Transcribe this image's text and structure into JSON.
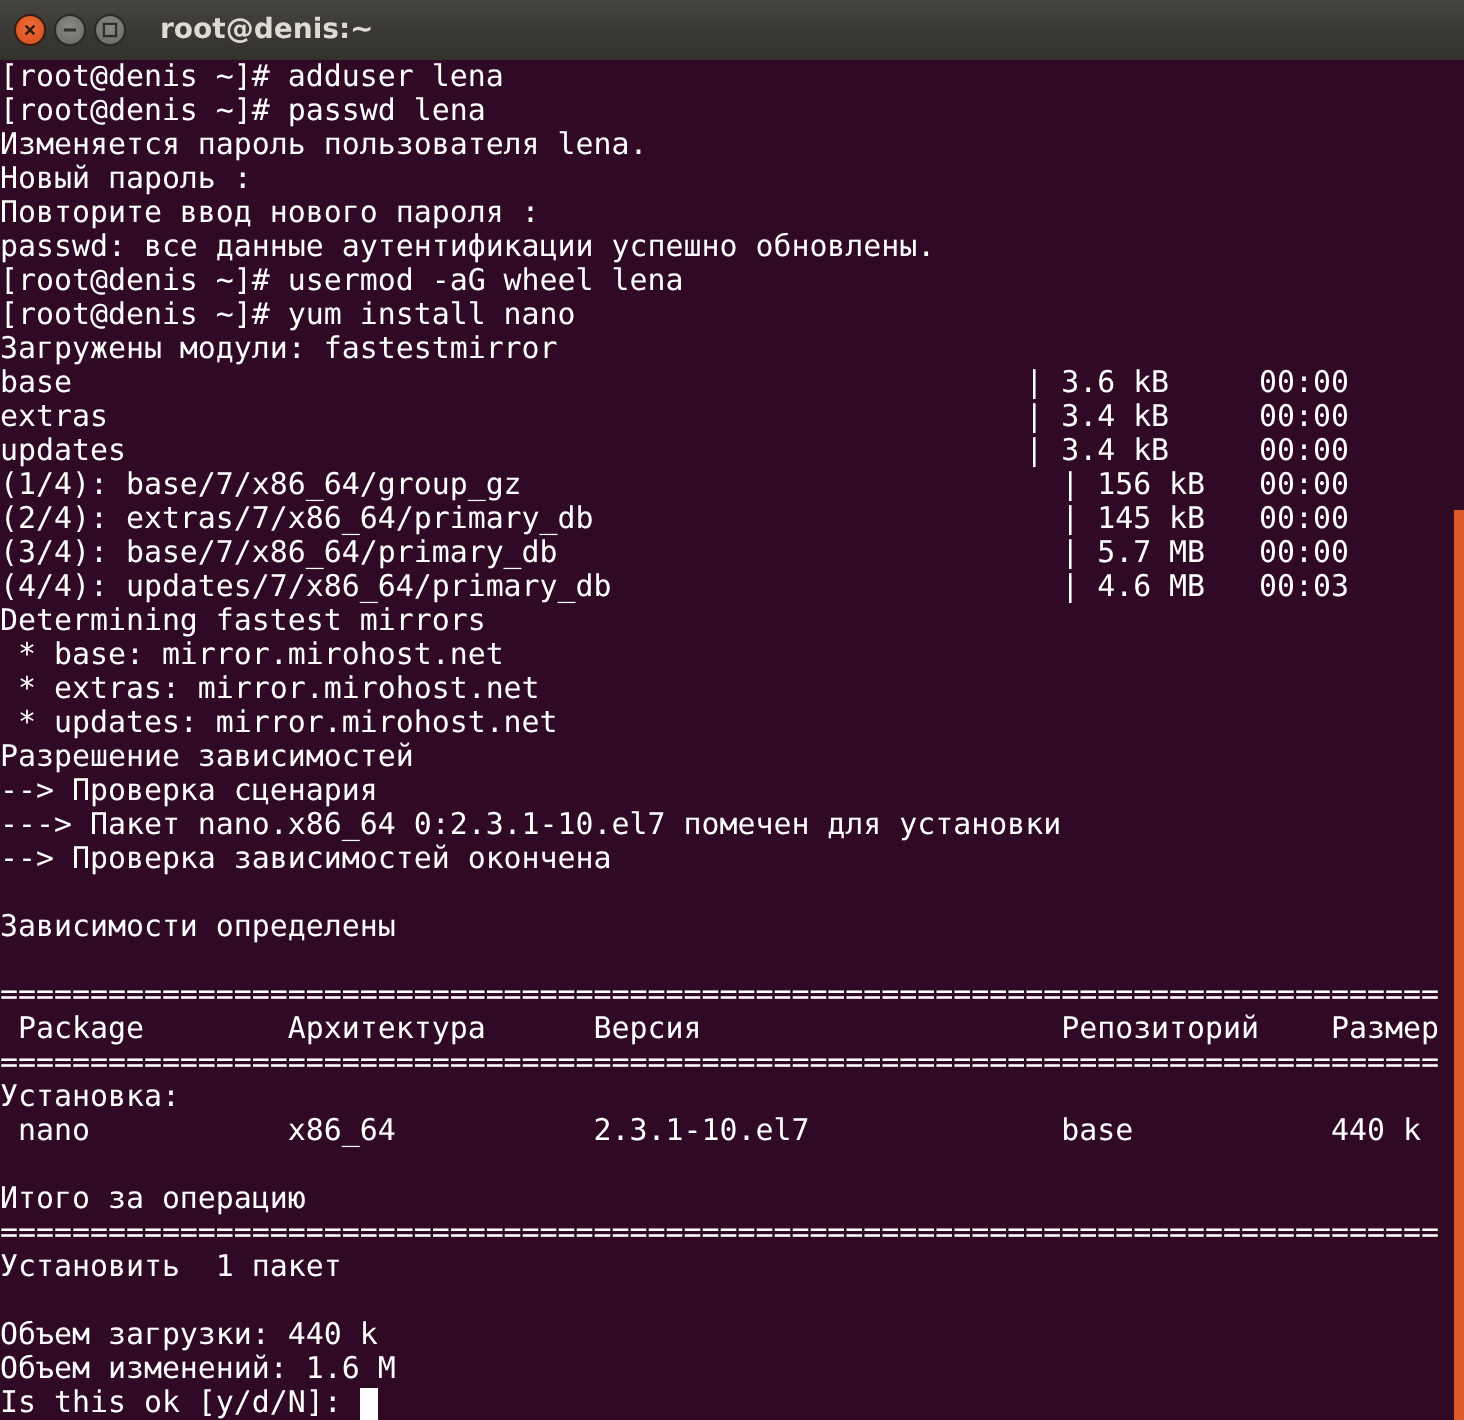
{
  "window": {
    "title": "root@denis:~"
  },
  "terminal": {
    "lines": [
      {
        "kind": "text",
        "text": "[root@denis ~]# adduser lena"
      },
      {
        "kind": "text",
        "text": "[root@denis ~]# passwd lena"
      },
      {
        "kind": "text",
        "text": "Изменяется пароль пользователя lena."
      },
      {
        "kind": "text",
        "text": "Новый пароль :"
      },
      {
        "kind": "text",
        "text": "Повторите ввод нового пароля :"
      },
      {
        "kind": "text",
        "text": "passwd: все данные аутентификации успешно обновлены."
      },
      {
        "kind": "text",
        "text": "[root@denis ~]# usermod -aG wheel lena"
      },
      {
        "kind": "text",
        "text": "[root@denis ~]# yum install nano"
      },
      {
        "kind": "text",
        "text": "Загружены модули: fastestmirror"
      },
      {
        "kind": "text",
        "text": "base                                                     | 3.6 kB     00:00"
      },
      {
        "kind": "text",
        "text": "extras                                                   | 3.4 kB     00:00"
      },
      {
        "kind": "text",
        "text": "updates                                                  | 3.4 kB     00:00"
      },
      {
        "kind": "text",
        "text": "(1/4): base/7/x86_64/group_gz                              | 156 kB   00:00"
      },
      {
        "kind": "text",
        "text": "(2/4): extras/7/x86_64/primary_db                          | 145 kB   00:00"
      },
      {
        "kind": "text",
        "text": "(3/4): base/7/x86_64/primary_db                            | 5.7 MB   00:00"
      },
      {
        "kind": "text",
        "text": "(4/4): updates/7/x86_64/primary_db                         | 4.6 MB   00:03"
      },
      {
        "kind": "text",
        "text": "Determining fastest mirrors"
      },
      {
        "kind": "text",
        "text": " * base: mirror.mirohost.net"
      },
      {
        "kind": "text",
        "text": " * extras: mirror.mirohost.net"
      },
      {
        "kind": "text",
        "text": " * updates: mirror.mirohost.net"
      },
      {
        "kind": "text",
        "text": "Разрешение зависимостей"
      },
      {
        "kind": "text",
        "text": "--> Проверка сценария"
      },
      {
        "kind": "text",
        "text": "---> Пакет nano.x86_64 0:2.3.1-10.el7 помечен для установки"
      },
      {
        "kind": "text",
        "text": "--> Проверка зависимостей окончена"
      },
      {
        "kind": "blank"
      },
      {
        "kind": "text",
        "text": "Зависимости определены"
      },
      {
        "kind": "blank"
      },
      {
        "kind": "text",
        "text": "================================================================================"
      },
      {
        "kind": "text",
        "text": " Package        Архитектура      Версия                    Репозиторий    Размер"
      },
      {
        "kind": "text",
        "text": "================================================================================"
      },
      {
        "kind": "text",
        "text": "Установка:"
      },
      {
        "kind": "text",
        "text": " nano           x86_64           2.3.1-10.el7              base           440 k"
      },
      {
        "kind": "blank"
      },
      {
        "kind": "text",
        "text": "Итого за операцию"
      },
      {
        "kind": "text",
        "text": "================================================================================"
      },
      {
        "kind": "text",
        "text": "Установить  1 пакет"
      },
      {
        "kind": "blank"
      },
      {
        "kind": "text",
        "text": "Объем загрузки: 440 k"
      },
      {
        "kind": "text",
        "text": "Объем изменений: 1.6 M"
      },
      {
        "kind": "text",
        "text": "Is this ok [y/d/N]: ",
        "cursor": true
      }
    ]
  }
}
